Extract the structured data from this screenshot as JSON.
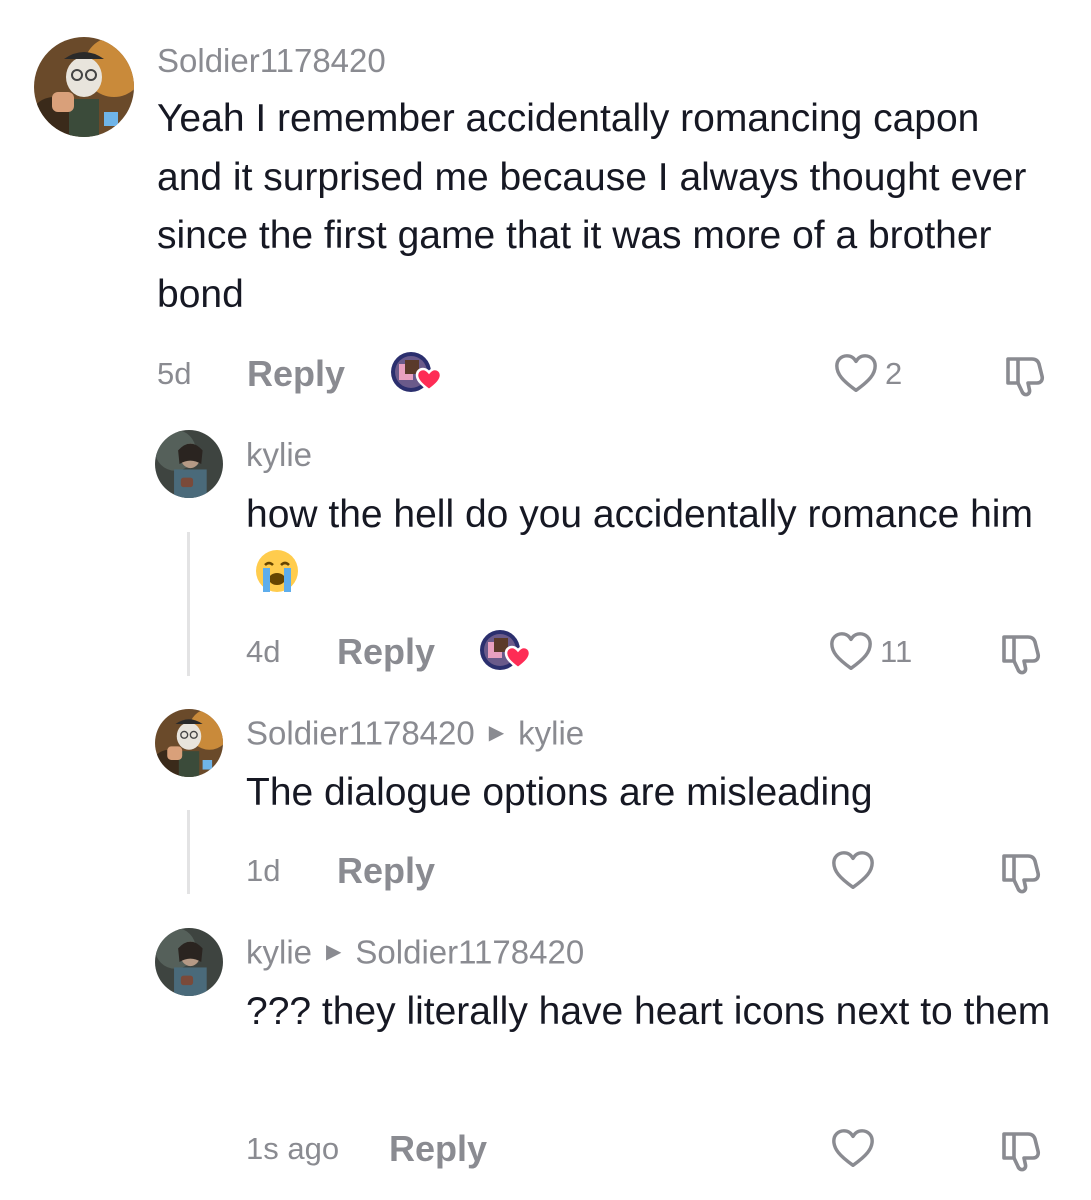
{
  "comments": [
    {
      "username": "Soldier1178420",
      "text": "Yeah I remember accidentally romancing capon and it surprised me because I always thought ever since the first game that it was more of a brother bond",
      "time": "5d",
      "reply_label": "Reply",
      "likes": "2",
      "liked_by_creator": true
    },
    {
      "username": "kylie",
      "text": "how the hell do you accidentally romance him",
      "emoji": "loudly-crying-face",
      "time": "4d",
      "reply_label": "Reply",
      "likes": "11",
      "liked_by_creator": true
    },
    {
      "username": "Soldier1178420",
      "reply_to": "kylie",
      "text": "The dialogue options are misleading",
      "time": "1d",
      "reply_label": "Reply",
      "likes": ""
    },
    {
      "username": "kylie",
      "reply_to": "Soldier1178420",
      "text": "??? they literally have heart icons next to them",
      "time": "1s ago",
      "reply_label": "Reply",
      "likes": ""
    }
  ],
  "icons": {
    "like": "heart-outline-icon",
    "dislike": "thumbs-down-icon",
    "reply_arrow": "triangle-right-icon",
    "liked_by": "creator-liked-heart-icon"
  },
  "colors": {
    "text": "#161823",
    "muted": "#8a8b91",
    "thread_line": "#e3e3e4",
    "creator_heart": "#fe2c55"
  }
}
